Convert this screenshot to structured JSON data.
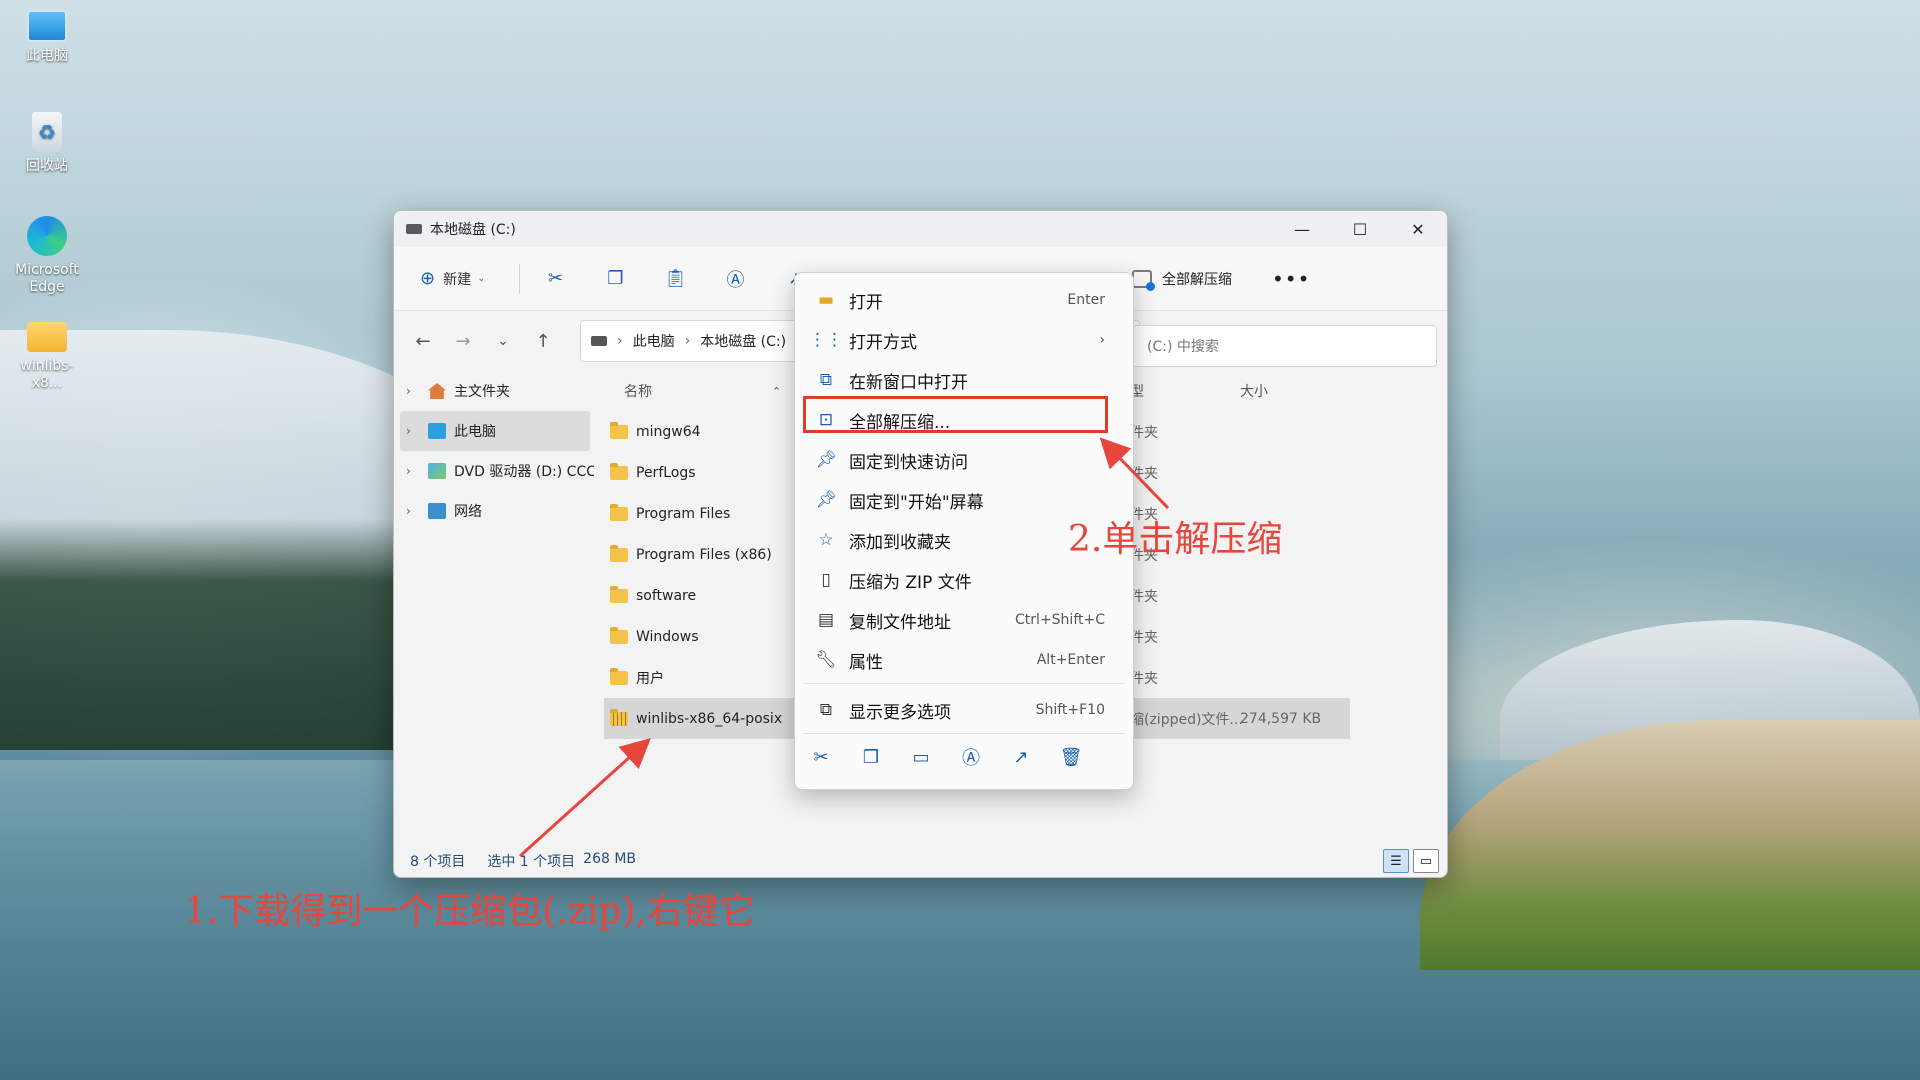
{
  "desktop": {
    "icons": [
      {
        "label": "此电脑"
      },
      {
        "label": "回收站"
      },
      {
        "label": "Microsoft Edge"
      },
      {
        "label": "winlibs-x8..."
      }
    ]
  },
  "window": {
    "title": "本地磁盘 (C:)",
    "controls": {
      "minimize": "—",
      "maximize": "☐",
      "close": "✕"
    },
    "toolbar": {
      "new_label": "新建",
      "extract_all_label": "全部解压缩",
      "more": "•••"
    },
    "breadcrumb": {
      "root": "此电脑",
      "current": "本地磁盘 (C:)"
    },
    "search_placeholder": "(C:) 中搜索",
    "sidebar": [
      {
        "label": "主文件夹"
      },
      {
        "label": "此电脑"
      },
      {
        "label": "DVD 驱动器 (D:) CCC"
      },
      {
        "label": "网络"
      }
    ],
    "columns": {
      "name": "名称",
      "type": "型",
      "size": "大小"
    },
    "files": [
      {
        "name": "mingw64",
        "type": "件夹"
      },
      {
        "name": "PerfLogs",
        "type": "件夹"
      },
      {
        "name": "Program Files",
        "type": "件夹"
      },
      {
        "name": "Program Files (x86)",
        "type": "件夹"
      },
      {
        "name": "software",
        "type": "件夹"
      },
      {
        "name": "Windows",
        "type": "件夹"
      },
      {
        "name": "用户",
        "type": "件夹"
      },
      {
        "name": "winlibs-x86_64-posix",
        "type": "缩(zipped)文件...",
        "size": "274,597 KB"
      }
    ],
    "status": {
      "count": "8 个项目",
      "selected": "选中 1 个项目",
      "size": "268 MB"
    }
  },
  "context_menu": {
    "items": [
      {
        "label": "打开",
        "shortcut": "Enter"
      },
      {
        "label": "打开方式",
        "shortcut": "›"
      },
      {
        "label": "在新窗口中打开",
        "shortcut": ""
      },
      {
        "label": "全部解压缩...",
        "shortcut": ""
      },
      {
        "label": "固定到快速访问",
        "shortcut": ""
      },
      {
        "label": "固定到\"开始\"屏幕",
        "shortcut": ""
      },
      {
        "label": "添加到收藏夹",
        "shortcut": ""
      },
      {
        "label": "压缩为 ZIP 文件",
        "shortcut": ""
      },
      {
        "label": "复制文件地址",
        "shortcut": "Ctrl+Shift+C"
      },
      {
        "label": "属性",
        "shortcut": "Alt+Enter"
      },
      {
        "label": "显示更多选项",
        "shortcut": "Shift+F10"
      }
    ]
  },
  "annotations": {
    "step1": "1.下载得到一个压缩包(.zip),右键它",
    "step2": "2.单击解压缩"
  },
  "colors": {
    "annotation": "#e8453c",
    "accent": "#1a5fb4",
    "selected_row": "#d6d6d6"
  }
}
